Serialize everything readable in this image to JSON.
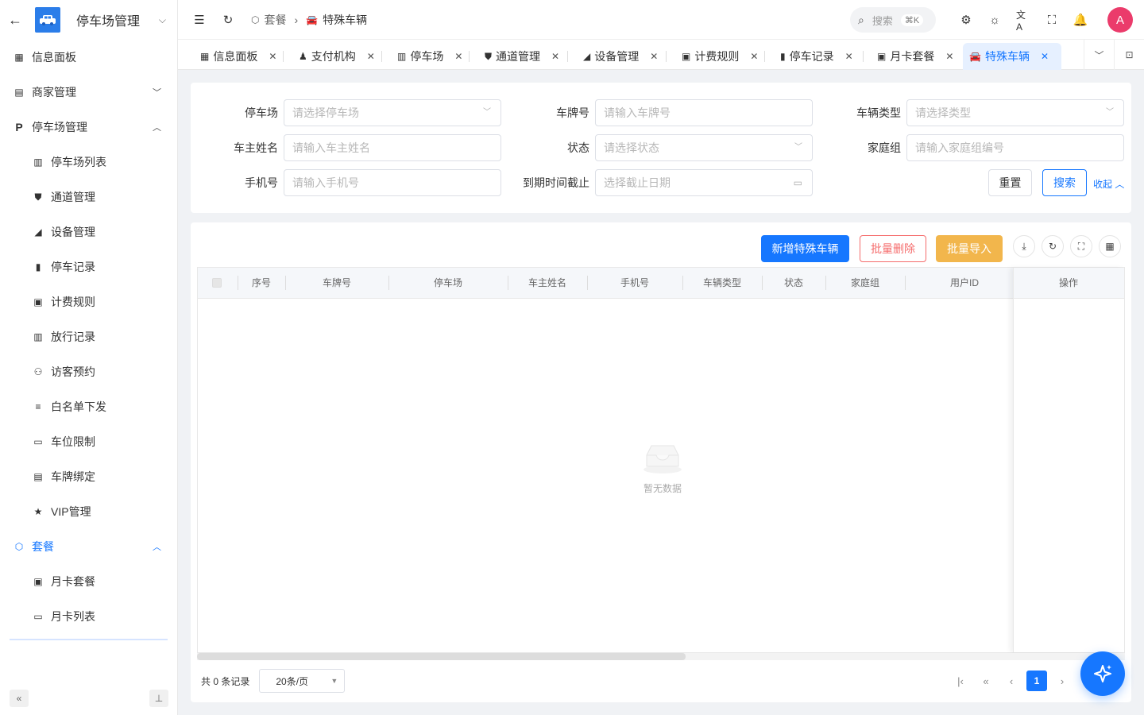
{
  "sidebar": {
    "title": "停车场管理",
    "items": [
      {
        "label": "信息面板",
        "icon": "dashboard-icon"
      },
      {
        "label": "商家管理",
        "icon": "store-icon"
      },
      {
        "label": "停车场管理",
        "icon": "parking-p-icon"
      },
      {
        "label": "停车场列表",
        "icon": "building-icon"
      },
      {
        "label": "通道管理",
        "icon": "road-icon"
      },
      {
        "label": "设备管理",
        "icon": "camera-icon"
      },
      {
        "label": "停车记录",
        "icon": "clipboard-icon"
      },
      {
        "label": "计费规则",
        "icon": "money-icon"
      },
      {
        "label": "放行记录",
        "icon": "gate-icon"
      },
      {
        "label": "访客预约",
        "icon": "visitor-icon"
      },
      {
        "label": "白名单下发",
        "icon": "checklist-icon"
      },
      {
        "label": "车位限制",
        "icon": "truck-icon"
      },
      {
        "label": "车牌绑定",
        "icon": "plate-icon"
      },
      {
        "label": "VIP管理",
        "icon": "star-icon"
      },
      {
        "label": "套餐",
        "icon": "cube-icon"
      },
      {
        "label": "月卡套餐",
        "icon": "id-card-icon"
      },
      {
        "label": "月卡列表",
        "icon": "card-list-icon"
      }
    ]
  },
  "header": {
    "breadcrumb": [
      "套餐",
      "特殊车辆"
    ],
    "search_label": "搜索",
    "search_kbd": "⌘K",
    "avatar_letter": "A"
  },
  "tabs": [
    "信息面板",
    "支付机构",
    "停车场",
    "通道管理",
    "设备管理",
    "计费规则",
    "停车记录",
    "月卡套餐",
    "特殊车辆"
  ],
  "filter": {
    "parking_label": "停车场",
    "parking_ph": "请选择停车场",
    "plate_label": "车牌号",
    "plate_ph": "请输入车牌号",
    "type_label": "车辆类型",
    "type_ph": "请选择类型",
    "owner_label": "车主姓名",
    "owner_ph": "请输入车主姓名",
    "status_label": "状态",
    "status_ph": "请选择状态",
    "family_label": "家庭组",
    "family_ph": "请输入家庭组编号",
    "phone_label": "手机号",
    "phone_ph": "请输入手机号",
    "expire_label": "到期时间截止",
    "expire_ph": "选择截止日期",
    "reset": "重置",
    "search": "搜索",
    "collapse": "收起"
  },
  "toolbar": {
    "add": "新增特殊车辆",
    "batch_delete": "批量删除",
    "batch_import": "批量导入"
  },
  "table": {
    "columns": [
      "序号",
      "车牌号",
      "停车场",
      "车主姓名",
      "手机号",
      "车辆类型",
      "状态",
      "家庭组",
      "用户ID",
      "操作"
    ],
    "empty_text": "暂无数据"
  },
  "pager": {
    "total": "共 0 条记录",
    "size": "20条/页",
    "current": "1"
  },
  "colors": {
    "primary": "#1677ff",
    "danger": "#f56c6c",
    "warning": "#f2b64c",
    "avatar": "#eb3b6b"
  }
}
